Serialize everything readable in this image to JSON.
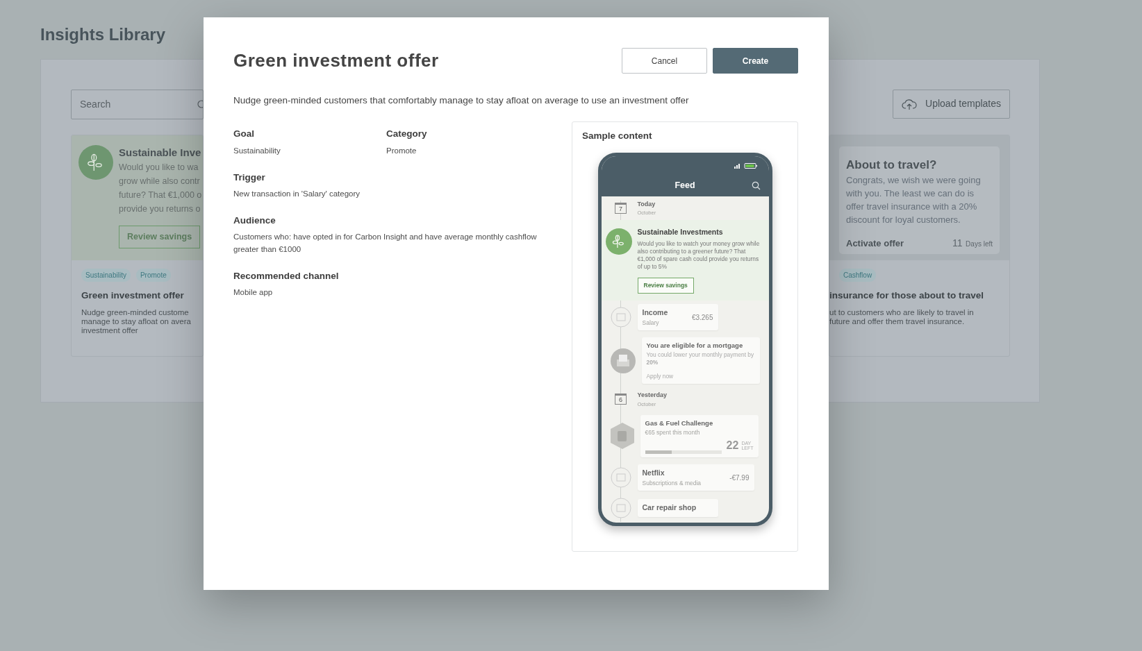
{
  "library": {
    "title": "Insights Library",
    "search": {
      "placeholder": "Search"
    },
    "upload_button": "Upload templates",
    "cards": [
      {
        "preview": {
          "kind": "nudge",
          "title": "Sustainable Inve",
          "lines": [
            "Would you like to wa",
            "grow while also contr",
            "future? That €1,000 o",
            "provide you returns o"
          ],
          "button": "Review savings"
        },
        "tags": [
          "Sustainability",
          "Promote"
        ],
        "title": "Green investment offer",
        "lines": [
          "Nudge green-minded custome",
          "manage to stay afloat on avera",
          "investment offer"
        ]
      },
      {
        "preview": {
          "kind": "offer",
          "title": "About to travel?",
          "body": "Congrats, we wish we were going with you. The least we can do is offer travel insurance with a 20% discount for loyal customers.",
          "action": "Activate offer",
          "count": "11",
          "count_label": "Days left"
        },
        "tags": [
          "Cashflow"
        ],
        "title": "insurance for those about to travel",
        "lines": [
          "ut to customers who are likely to travel in",
          "future and offer them travel insurance."
        ]
      }
    ]
  },
  "modal": {
    "title": "Green investment offer",
    "buttons": [
      {
        "label": "Cancel",
        "kind": "secondary"
      },
      {
        "label": "Create",
        "kind": "primary"
      }
    ],
    "description": "Nudge green-minded customers that comfortably manage to stay afloat on average to use an investment offer",
    "field_rows": [
      [
        {
          "label": "Goal",
          "value": "Sustainability"
        },
        {
          "label": "Category",
          "value": "Promote"
        }
      ],
      [
        {
          "label": "Trigger",
          "value": "New transaction in 'Salary' category"
        }
      ],
      [
        {
          "label": "Audience",
          "value": "Customers who: have opted in for Carbon Insight and have average monthly cashflow greater than €1000"
        }
      ],
      [
        {
          "label": "Recommended channel",
          "value": "Mobile app"
        }
      ]
    ],
    "sample": {
      "title": "Sample content",
      "phone": {
        "header": "Feed",
        "feed": [
          {
            "kind": "day",
            "title": "Today",
            "subtitle": "October",
            "date": "7"
          },
          {
            "kind": "nudge",
            "title": "Sustainable Investments",
            "body": "Would you like to watch your money grow while also contributing to a greener future? That €1,000 of spare cash could provide you returns of up to 5%",
            "button": "Review savings"
          },
          {
            "kind": "transaction",
            "title": "Income",
            "subtitle": "Salary",
            "amount": "€3.265"
          },
          {
            "kind": "offer",
            "title": "You are eligible for a mortgage",
            "body": "You could lower your monthly payment by **20%**",
            "action": "Apply now"
          },
          {
            "kind": "day",
            "title": "Yesterday",
            "subtitle": "October",
            "date": "6"
          },
          {
            "kind": "challenge",
            "title": "Gas & Fuel Challenge",
            "subtitle": "€65 spent this month",
            "level": 0.35,
            "days": "22",
            "unit": [
              "DAY",
              "LEFT"
            ]
          },
          {
            "kind": "transaction",
            "title": "Netflix",
            "subtitle": "Subscriptions & media",
            "amount": "-€7.99"
          },
          {
            "kind": "transaction",
            "title": "Car repair shop"
          }
        ]
      }
    }
  }
}
